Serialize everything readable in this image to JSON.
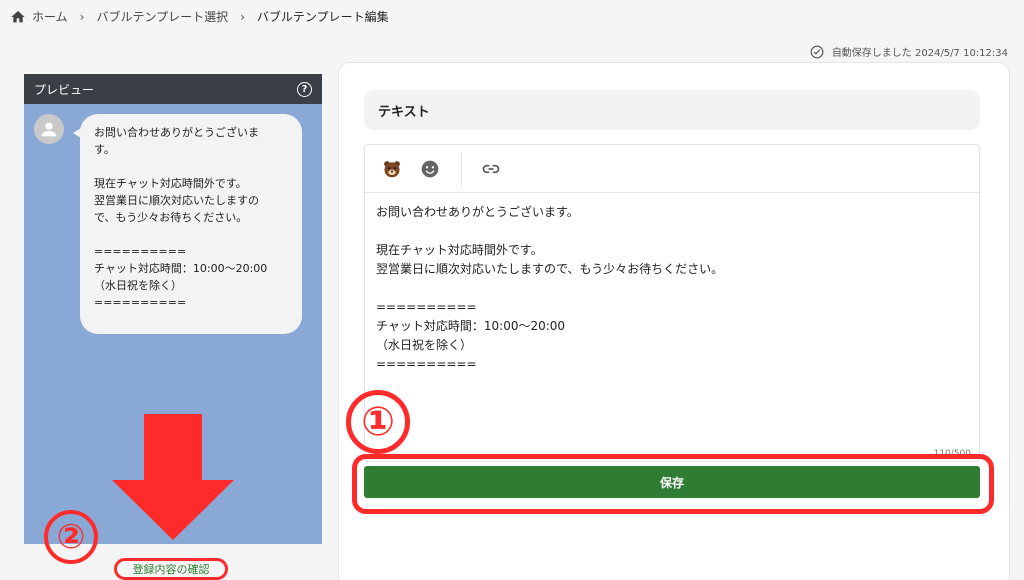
{
  "breadcrumb": {
    "home": "ホーム",
    "items": [
      "バブルテンプレート選択",
      "バブルテンプレート編集"
    ]
  },
  "autosave": {
    "text": "自動保存しました 2024/5/7 10:12:34"
  },
  "preview": {
    "title": "プレビュー",
    "message": "お問い合わせありがとうございま\nす。\n\n現在チャット対応時間外です。\n翌営業日に順次対応いたしますの\nで、もう少々お待ちください。\n\n==========\nチャット対応時間：10:00～20:00\n（水日祝を除く）\n=========="
  },
  "confirm_link": "登録内容の確認",
  "editor": {
    "section_title": "テキスト",
    "text": "お問い合わせありがとうございます。\n\n現在チャット対応時間外です。\n翌営業日に順次対応いたしますので、もう少々お待ちください。\n\n==========\nチャット対応時間：10:00～20:00\n（水日祝を除く）\n==========",
    "counter": "110/500"
  },
  "save_label": "保存",
  "annotations": {
    "step1": "①",
    "step2": "②"
  },
  "colors": {
    "save": "#2e7d32",
    "annotation": "#ff2b2b",
    "preview_bg": "#8aa8d5",
    "header": "#3a3f45"
  }
}
